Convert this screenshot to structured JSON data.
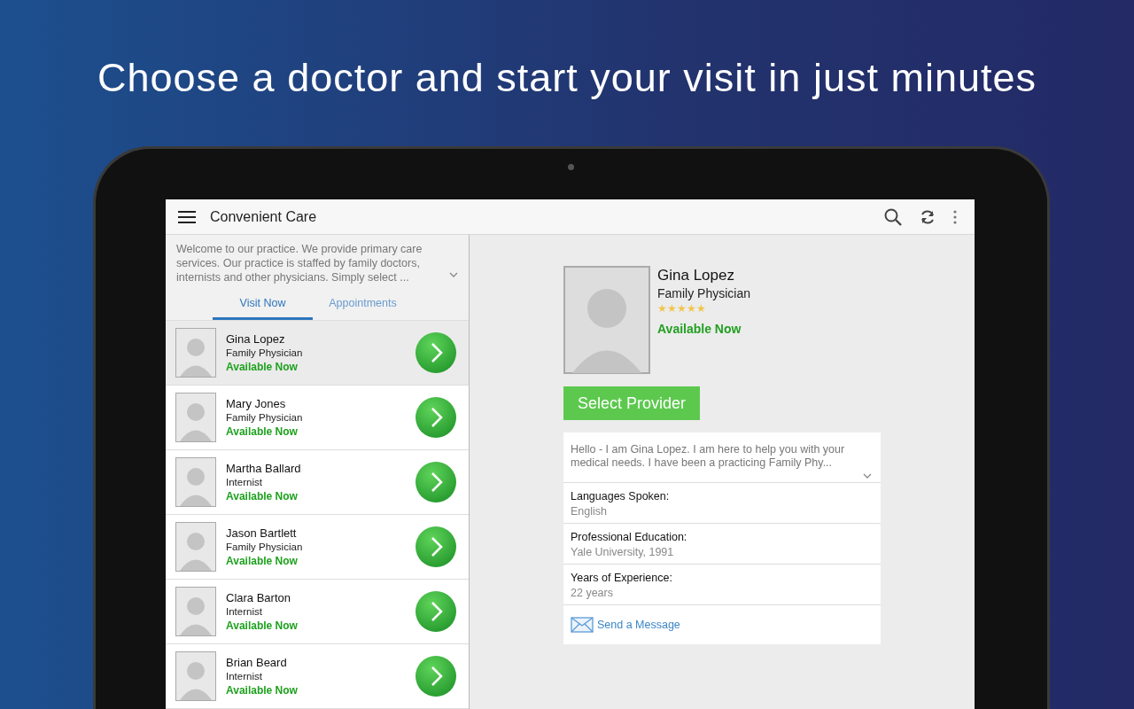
{
  "headline": "Choose a doctor and start your visit in just minutes",
  "app_bar": {
    "title": "Convenient Care"
  },
  "intro": {
    "text": "Welcome to our practice. We provide primary care services. Our practice is staffed by family doctors, internists and other physicians. Simply select ..."
  },
  "tabs": [
    {
      "label": "Visit Now",
      "selected": true
    },
    {
      "label": "Appointments",
      "selected": false
    }
  ],
  "doctors": [
    {
      "name": "Gina Lopez",
      "specialty": "Family Physician",
      "status": "Available Now",
      "selected": true
    },
    {
      "name": "Mary Jones",
      "specialty": "Family Physician",
      "status": "Available Now",
      "selected": false
    },
    {
      "name": "Martha Ballard",
      "specialty": "Internist",
      "status": "Available Now",
      "selected": false
    },
    {
      "name": "Jason Bartlett",
      "specialty": "Family Physician",
      "status": "Available Now",
      "selected": false
    },
    {
      "name": "Clara Barton",
      "specialty": "Internist",
      "status": "Available Now",
      "selected": false
    },
    {
      "name": "Brian Beard",
      "specialty": "Internist",
      "status": "Available Now",
      "selected": false
    }
  ],
  "profile": {
    "name": "Gina Lopez",
    "specialty": "Family Physician",
    "stars": 5,
    "status": "Available Now",
    "button": "Select Provider",
    "bio": "Hello - I am Gina Lopez. I am here to help you with your medical needs. I have been a practicing Family Phy...",
    "details": [
      {
        "label": "Languages Spoken:",
        "value": "English"
      },
      {
        "label": "Professional Education:",
        "value": "Yale University, 1991"
      },
      {
        "label": "Years of Experience:",
        "value": "22 years"
      }
    ],
    "message_link": "Send a Message"
  }
}
